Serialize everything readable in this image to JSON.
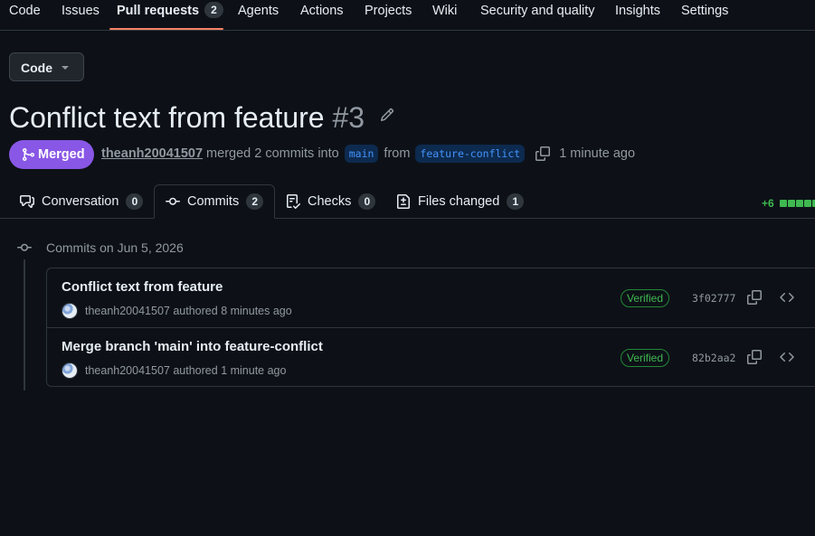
{
  "nav": {
    "items": [
      {
        "label": "Code"
      },
      {
        "label": "Issues"
      },
      {
        "label": "Pull requests",
        "count": "2",
        "active": true
      },
      {
        "label": "Agents"
      },
      {
        "label": "Actions"
      },
      {
        "label": "Projects"
      },
      {
        "label": "Wiki"
      },
      {
        "label": "Security and quality"
      },
      {
        "label": "Insights"
      },
      {
        "label": "Settings"
      }
    ]
  },
  "code_button": {
    "label": "Code"
  },
  "pr": {
    "title": "Conflict text from feature",
    "number": "#3",
    "state_label": "Merged",
    "author": "theanh20041507",
    "merged_text": "merged 2 commits into",
    "base_branch": "main",
    "from_text": "from",
    "head_branch": "feature-conflict",
    "time_ago": "1 minute ago"
  },
  "tabs": [
    {
      "label": "Conversation",
      "count": "0",
      "icon": "comment-discussion-icon"
    },
    {
      "label": "Commits",
      "count": "2",
      "icon": "git-commit-icon",
      "active": true
    },
    {
      "label": "Checks",
      "count": "0",
      "icon": "checklist-icon"
    },
    {
      "label": "Files changed",
      "count": "1",
      "icon": "file-diff-icon"
    }
  ],
  "diffstat": {
    "additions": "+6"
  },
  "commits": {
    "date_heading": "Commits on Jun 5, 2026",
    "items": [
      {
        "message": "Conflict text from feature",
        "author": "theanh20041507",
        "authored_text": "authored",
        "time_ago": "8 minutes ago",
        "verified_label": "Verified",
        "sha": "3f02777"
      },
      {
        "message": "Merge branch 'main' into feature-conflict",
        "author": "theanh20041507",
        "authored_text": "authored",
        "time_ago": "1 minute ago",
        "verified_label": "Verified",
        "sha": "82b2aa2"
      }
    ]
  },
  "colors": {
    "background": "#0d1117",
    "merged_purple": "#8957e5",
    "nav_underline": "#f78166",
    "verified_green": "#3fb950",
    "branch_blue": "#4493f8"
  }
}
